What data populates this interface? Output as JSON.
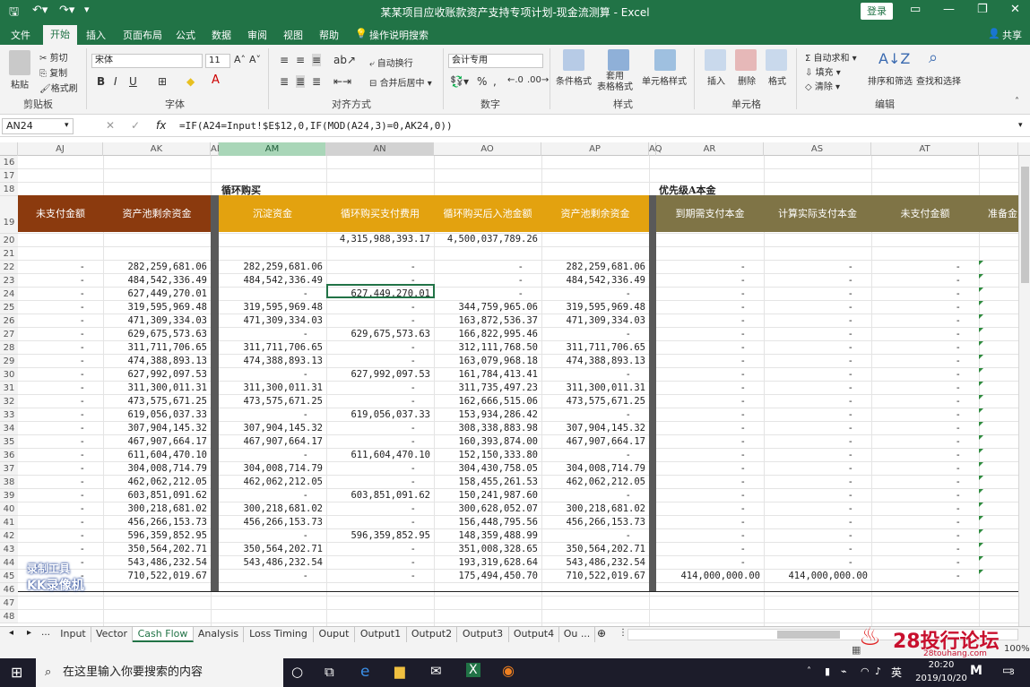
{
  "window": {
    "title": "某某项目应收账款资产支持专项计划-现金流测算 - Excel",
    "login": "登录",
    "share": "共享"
  },
  "ribbon_tabs": [
    "文件",
    "开始",
    "插入",
    "页面布局",
    "公式",
    "数据",
    "审阅",
    "视图",
    "帮助",
    "操作说明搜索"
  ],
  "ribbon": {
    "clipboard": {
      "label": "剪贴板",
      "paste": "粘贴",
      "cut": "剪切",
      "copy": "复制",
      "format_painter": "格式刷"
    },
    "font": {
      "label": "字体",
      "name": "宋体",
      "size": "11",
      "bold": "B",
      "italic": "I",
      "underline": "U"
    },
    "alignment": {
      "label": "对齐方式",
      "wrap": "自动换行",
      "merge": "合并后居中"
    },
    "number": {
      "label": "数字",
      "format": "会计专用",
      "percent": "%"
    },
    "styles": {
      "label": "样式",
      "conditional": "条件格式",
      "table": "套用\n表格格式",
      "cell_styles": "单元格样式"
    },
    "cells": {
      "label": "单元格",
      "insert": "插入",
      "delete": "删除",
      "format": "格式"
    },
    "editing": {
      "label": "编辑",
      "autosum": "自动求和",
      "fill": "填充",
      "clear": "清除",
      "sort": "排序和筛选",
      "find": "查找和选择"
    }
  },
  "formula_bar": {
    "name_box": "AN24",
    "fx": "fx",
    "formula": "=IF(A24=Input!$E$12,0,IF(MOD(A24,3)=0,AK24,0))"
  },
  "columns": [
    "AJ",
    "AK",
    "AL",
    "AM",
    "AN",
    "AO",
    "AP",
    "AQ",
    "AR",
    "AS",
    "AT"
  ],
  "section_titles": {
    "revolving": "循环购买",
    "priority": "优先级A本金"
  },
  "headers": {
    "AJ": "未支付金额",
    "AK": "资产池剩余资金",
    "AM": "沉淀资金",
    "AN": "循环购买支付费用",
    "AO": "循环购买后入池金额",
    "AP": "资产池剩余资金",
    "AR": "到期需支付本金",
    "AS": "计算实际支付本金",
    "AT": "未支付金额",
    "AU": "准备金"
  },
  "row20": {
    "AN": "4,315,988,393.17",
    "AO": "4,500,037,789.26"
  },
  "rows": [
    {
      "r": "22",
      "AJ": "-",
      "AK": "282,259,681.06",
      "AM": "282,259,681.06",
      "AN": "-",
      "AO": "-",
      "AP": "282,259,681.06",
      "AR": "-",
      "AS": "-",
      "AT": "-"
    },
    {
      "r": "23",
      "AJ": "-",
      "AK": "484,542,336.49",
      "AM": "484,542,336.49",
      "AN": "-",
      "AO": "-",
      "AP": "484,542,336.49",
      "AR": "-",
      "AS": "-",
      "AT": "-"
    },
    {
      "r": "24",
      "AJ": "-",
      "AK": "627,449,270.01",
      "AM": "-",
      "AN": "627,449,270.01",
      "AO": "-",
      "AP": "-",
      "AR": "-",
      "AS": "-",
      "AT": "-"
    },
    {
      "r": "25",
      "AJ": "-",
      "AK": "319,595,969.48",
      "AM": "319,595,969.48",
      "AN": "-",
      "AO": "344,759,965.06",
      "AP": "319,595,969.48",
      "AR": "-",
      "AS": "-",
      "AT": "-"
    },
    {
      "r": "26",
      "AJ": "-",
      "AK": "471,309,334.03",
      "AM": "471,309,334.03",
      "AN": "-",
      "AO": "163,872,536.37",
      "AP": "471,309,334.03",
      "AR": "-",
      "AS": "-",
      "AT": "-"
    },
    {
      "r": "27",
      "AJ": "-",
      "AK": "629,675,573.63",
      "AM": "-",
      "AN": "629,675,573.63",
      "AO": "166,822,995.46",
      "AP": "-",
      "AR": "-",
      "AS": "-",
      "AT": "-"
    },
    {
      "r": "28",
      "AJ": "-",
      "AK": "311,711,706.65",
      "AM": "311,711,706.65",
      "AN": "-",
      "AO": "312,111,768.50",
      "AP": "311,711,706.65",
      "AR": "-",
      "AS": "-",
      "AT": "-"
    },
    {
      "r": "29",
      "AJ": "-",
      "AK": "474,388,893.13",
      "AM": "474,388,893.13",
      "AN": "-",
      "AO": "163,079,968.18",
      "AP": "474,388,893.13",
      "AR": "-",
      "AS": "-",
      "AT": "-"
    },
    {
      "r": "30",
      "AJ": "-",
      "AK": "627,992,097.53",
      "AM": "-",
      "AN": "627,992,097.53",
      "AO": "161,784,413.41",
      "AP": "-",
      "AR": "-",
      "AS": "-",
      "AT": "-"
    },
    {
      "r": "31",
      "AJ": "-",
      "AK": "311,300,011.31",
      "AM": "311,300,011.31",
      "AN": "-",
      "AO": "311,735,497.23",
      "AP": "311,300,011.31",
      "AR": "-",
      "AS": "-",
      "AT": "-"
    },
    {
      "r": "32",
      "AJ": "-",
      "AK": "473,575,671.25",
      "AM": "473,575,671.25",
      "AN": "-",
      "AO": "162,666,515.06",
      "AP": "473,575,671.25",
      "AR": "-",
      "AS": "-",
      "AT": "-"
    },
    {
      "r": "33",
      "AJ": "-",
      "AK": "619,056,037.33",
      "AM": "-",
      "AN": "619,056,037.33",
      "AO": "153,934,286.42",
      "AP": "-",
      "AR": "-",
      "AS": "-",
      "AT": "-"
    },
    {
      "r": "34",
      "AJ": "-",
      "AK": "307,904,145.32",
      "AM": "307,904,145.32",
      "AN": "-",
      "AO": "308,338,883.98",
      "AP": "307,904,145.32",
      "AR": "-",
      "AS": "-",
      "AT": "-"
    },
    {
      "r": "35",
      "AJ": "-",
      "AK": "467,907,664.17",
      "AM": "467,907,664.17",
      "AN": "-",
      "AO": "160,393,874.00",
      "AP": "467,907,664.17",
      "AR": "-",
      "AS": "-",
      "AT": "-"
    },
    {
      "r": "36",
      "AJ": "-",
      "AK": "611,604,470.10",
      "AM": "-",
      "AN": "611,604,470.10",
      "AO": "152,150,333.80",
      "AP": "-",
      "AR": "-",
      "AS": "-",
      "AT": "-"
    },
    {
      "r": "37",
      "AJ": "-",
      "AK": "304,008,714.79",
      "AM": "304,008,714.79",
      "AN": "-",
      "AO": "304,430,758.05",
      "AP": "304,008,714.79",
      "AR": "-",
      "AS": "-",
      "AT": "-"
    },
    {
      "r": "38",
      "AJ": "-",
      "AK": "462,062,212.05",
      "AM": "462,062,212.05",
      "AN": "-",
      "AO": "158,455,261.53",
      "AP": "462,062,212.05",
      "AR": "-",
      "AS": "-",
      "AT": "-"
    },
    {
      "r": "39",
      "AJ": "-",
      "AK": "603,851,091.62",
      "AM": "-",
      "AN": "603,851,091.62",
      "AO": "150,241,987.60",
      "AP": "-",
      "AR": "-",
      "AS": "-",
      "AT": "-"
    },
    {
      "r": "40",
      "AJ": "-",
      "AK": "300,218,681.02",
      "AM": "300,218,681.02",
      "AN": "-",
      "AO": "300,628,052.07",
      "AP": "300,218,681.02",
      "AR": "-",
      "AS": "-",
      "AT": "-"
    },
    {
      "r": "41",
      "AJ": "-",
      "AK": "456,266,153.73",
      "AM": "456,266,153.73",
      "AN": "-",
      "AO": "156,448,795.56",
      "AP": "456,266,153.73",
      "AR": "-",
      "AS": "-",
      "AT": "-"
    },
    {
      "r": "42",
      "AJ": "-",
      "AK": "596,359,852.95",
      "AM": "-",
      "AN": "596,359,852.95",
      "AO": "148,359,488.99",
      "AP": "-",
      "AR": "-",
      "AS": "-",
      "AT": "-"
    },
    {
      "r": "43",
      "AJ": "-",
      "AK": "350,564,202.71",
      "AM": "350,564,202.71",
      "AN": "-",
      "AO": "351,008,328.65",
      "AP": "350,564,202.71",
      "AR": "-",
      "AS": "-",
      "AT": "-"
    },
    {
      "r": "44",
      "AJ": "-",
      "AK": "543,486,232.54",
      "AM": "543,486,232.54",
      "AN": "-",
      "AO": "193,319,628.64",
      "AP": "543,486,232.54",
      "AR": "-",
      "AS": "-",
      "AT": "-"
    },
    {
      "r": "45",
      "AJ": "-",
      "AK": "710,522,019.67",
      "AM": "-",
      "AN": "-",
      "AO": "175,494,450.70",
      "AP": "710,522,019.67",
      "AR": "414,000,000.00",
      "AS": "414,000,000.00",
      "AT": "-"
    }
  ],
  "row_numbers": [
    "16",
    "17",
    "18",
    "19",
    "20",
    "21",
    "22",
    "23",
    "24",
    "25",
    "26",
    "27",
    "28",
    "29",
    "30",
    "31",
    "32",
    "33",
    "34",
    "35",
    "36",
    "37",
    "38",
    "39",
    "40",
    "41",
    "42",
    "43",
    "44",
    "45",
    "46",
    "47",
    "48"
  ],
  "sheet_tabs": [
    "Input",
    "Vector",
    "Cash Flow",
    "Analysis",
    "Loss Timing",
    "Ouput",
    "Output1",
    "Output2",
    "Output3",
    "Output4",
    "Ou ..."
  ],
  "active_sheet": "Cash Flow",
  "status": {
    "zoom": "100%"
  },
  "watermark": {
    "line1": "录制工具",
    "line2": "KK录像机",
    "brand": "28投行论坛",
    "brand_url": "28touhang.com"
  },
  "taskbar": {
    "search": "在这里输入你要搜索的内容",
    "time": "20:20",
    "date": "2019/10/20",
    "ime": "英",
    "notif": "3"
  },
  "colors": {
    "excel_green": "#217346",
    "brown": "#8B3A0E",
    "gold": "#E3A20F",
    "olive": "#7F7446",
    "dark_sep": "#595959"
  }
}
